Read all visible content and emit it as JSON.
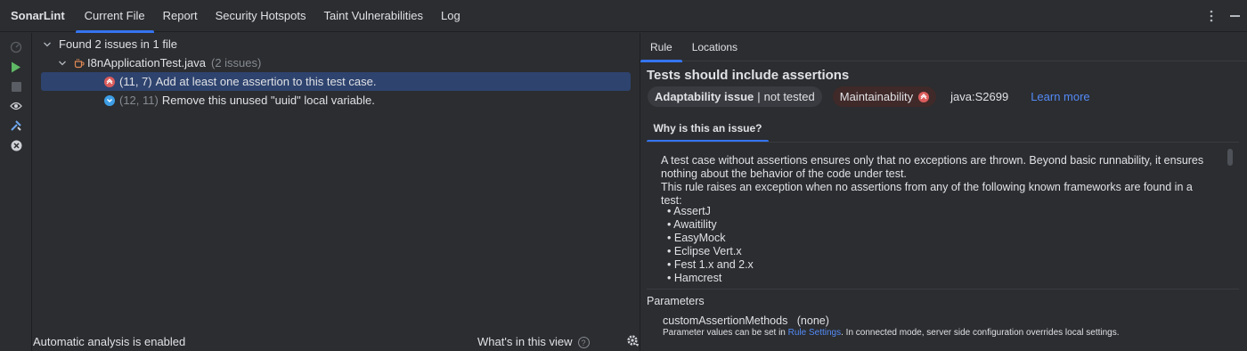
{
  "app_title": "SonarLint",
  "tabs": [
    {
      "label": "Current File",
      "active": true
    },
    {
      "label": "Report",
      "active": false
    },
    {
      "label": "Security Hotspots",
      "active": false
    },
    {
      "label": "Taint Vulnerabilities",
      "active": false
    },
    {
      "label": "Log",
      "active": false
    }
  ],
  "toolbar": {
    "icons": [
      "analyze-icon",
      "run-icon",
      "stop-icon",
      "eye-icon",
      "tools-icon",
      "clear-icon"
    ]
  },
  "tree": {
    "root_label": "Found 2 issues in 1 file",
    "file": {
      "name": "I8nApplicationTest.java",
      "count": "(2 issues)"
    },
    "issues": [
      {
        "location": "(11, 7)",
        "message": "Add at least one assertion to this test case.",
        "severity": "blocker",
        "selected": true
      },
      {
        "location": "(12, 11)",
        "message": "Remove this unused \"uuid\" local variable.",
        "severity": "minor",
        "selected": false
      }
    ]
  },
  "status": {
    "analysis": "Automatic analysis is enabled",
    "whats_in_view": "What's in this view",
    "help_glyph": "?"
  },
  "right_tabs": [
    {
      "label": "Rule",
      "active": true
    },
    {
      "label": "Locations",
      "active": false
    }
  ],
  "rule": {
    "title": "Tests should include assertions",
    "attribute_bold": "Adaptability issue",
    "attribute_sep": "|",
    "attribute_rest": "not tested",
    "impact": "Maintainability",
    "key": "java:S2699",
    "learn_more": "Learn more",
    "why_tab": "Why is this an issue?",
    "description_1": "A test case without assertions ensures only that no exceptions are thrown. Beyond basic runnability, it ensures nothing about the behavior of the code under test.",
    "description_2": "This rule raises an exception when no assertions from any of the following known frameworks are found in a test:",
    "frameworks": [
      "AssertJ",
      "Awaitility",
      "EasyMock",
      "Eclipse Vert.x",
      "Fest 1.x and 2.x",
      "Hamcrest"
    ],
    "parameters_title": "Parameters",
    "param_name": "customAssertionMethods",
    "param_value": "(none)",
    "param_help_1": "Parameter values can be set in ",
    "param_help_link": "Rule Settings",
    "param_help_2": ". In connected mode, server side configuration overrides local settings."
  },
  "colors": {
    "accent": "#3574f0",
    "blocker": "#db5c5c",
    "minor": "#3d9ee6",
    "link": "#548af7"
  }
}
